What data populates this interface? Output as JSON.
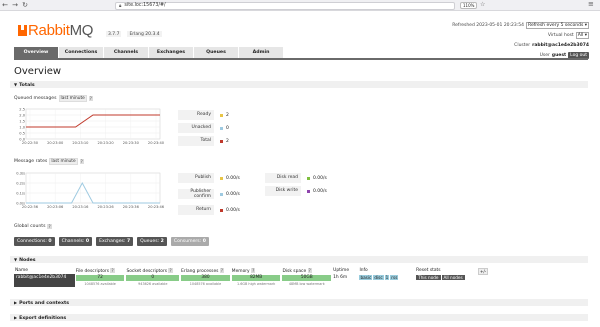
{
  "browser": {
    "url": "site.loc:15673/#/",
    "zoom": "110%"
  },
  "header": {
    "logo_rabbit": "Rabbit",
    "logo_mq": "MQ",
    "version": "3.7.7",
    "erlang": "Erlang 20.3.4",
    "refreshed_label": "Refreshed 2023-05-01 20:23:54",
    "refresh_select": "Refresh every 5 seconds",
    "vhost_label": "Virtual host",
    "vhost_value": "All",
    "cluster_label": "Cluster",
    "cluster_value": "rabbit@ac1e4e2b3074",
    "user_label": "User",
    "user_value": "guest",
    "logout_label": "Log out"
  },
  "tabs": [
    "Overview",
    "Connections",
    "Channels",
    "Exchanges",
    "Queues",
    "Admin"
  ],
  "page_title": "Overview",
  "totals": {
    "section_title": "Totals",
    "queued_label": "Queued messages",
    "queued_range": "last minute",
    "help": "?",
    "rates_label": "Message rates",
    "rates_range": "last minute"
  },
  "chart_data": [
    {
      "type": "line",
      "x": [
        "20:22:50",
        "20:23:00",
        "20:23:10",
        "20:23:20",
        "20:23:30",
        "20:23:40"
      ],
      "yticks": [
        "0.0",
        "0.5",
        "1.0",
        "1.5",
        "2.0",
        "2.5"
      ],
      "ylim": [
        0,
        2.5
      ],
      "series": [
        {
          "color": "#c0392b",
          "points": [
            [
              0,
              1.0
            ],
            [
              0.37,
              1.0
            ],
            [
              0.5,
              2.0
            ],
            [
              1.0,
              2.0
            ]
          ]
        }
      ]
    },
    {
      "type": "line",
      "x": [
        "20:22:56",
        "20:23:06",
        "20:23:16",
        "20:23:26",
        "20:23:36",
        "20:23:46"
      ],
      "yticks": [
        "0.0/s",
        "0.1/s",
        "0.2/s",
        "0.3/s"
      ],
      "ylim": [
        0,
        0.3
      ],
      "series": [
        {
          "color": "#9ecae1",
          "points": [
            [
              0,
              0
            ],
            [
              0.34,
              0
            ],
            [
              0.42,
              0.2
            ],
            [
              0.5,
              0
            ],
            [
              1.0,
              0
            ]
          ]
        }
      ]
    }
  ],
  "queued_legend": [
    {
      "label": "Ready",
      "color": "#e8c547",
      "value": "2"
    },
    {
      "label": "Unacked",
      "color": "#9ecae1",
      "value": "0"
    },
    {
      "label": "Total",
      "color": "#c0392b",
      "value": "2"
    }
  ],
  "rates_legend_left": [
    {
      "label": "Publish",
      "color": "#e8c547",
      "value": "0.00/s"
    },
    {
      "label": "Publisher confirm",
      "color": "#9ecae1",
      "value": "0.00/s"
    },
    {
      "label": "Return",
      "color": "#c0392b",
      "value": "0.00/s"
    }
  ],
  "rates_legend_right": [
    {
      "label": "Disk read",
      "color": "#7fbf3f",
      "value": "0.00/s"
    },
    {
      "label": "Disk write",
      "color": "#8e44ad",
      "value": "0.00/s"
    }
  ],
  "global_counts": {
    "label": "Global counts",
    "items": [
      {
        "label": "Connections:",
        "value": "0"
      },
      {
        "label": "Channels:",
        "value": "0"
      },
      {
        "label": "Exchanges:",
        "value": "7"
      },
      {
        "label": "Queues:",
        "value": "2"
      },
      {
        "label": "Consumers:",
        "value": "0"
      }
    ]
  },
  "nodes": {
    "section_title": "Nodes",
    "columns": [
      "Name",
      "File descriptors",
      "Socket descriptors",
      "Erlang processes",
      "Memory",
      "Disk space",
      "Uptime",
      "Info",
      "Reset stats"
    ],
    "row": {
      "name": "rabbit@ac1e4e2b3074",
      "fd": "72",
      "fd_sub": "1048576 available",
      "sd": "0",
      "sd_sub": "943626 available",
      "erl": "380",
      "erl_sub": "1048576 available",
      "mem": "82MB",
      "mem_sub": "1.6GB high watermark",
      "disk": "50GB",
      "disk_sub": "48MB low watermark",
      "uptime": "1h 6m",
      "info": [
        "basic",
        "disc",
        "1",
        "rss"
      ],
      "reset": [
        "This node",
        "All nodes"
      ]
    },
    "plusminus": "+/-"
  },
  "ports_title": "Ports and contexts",
  "export_title": "Export definitions"
}
